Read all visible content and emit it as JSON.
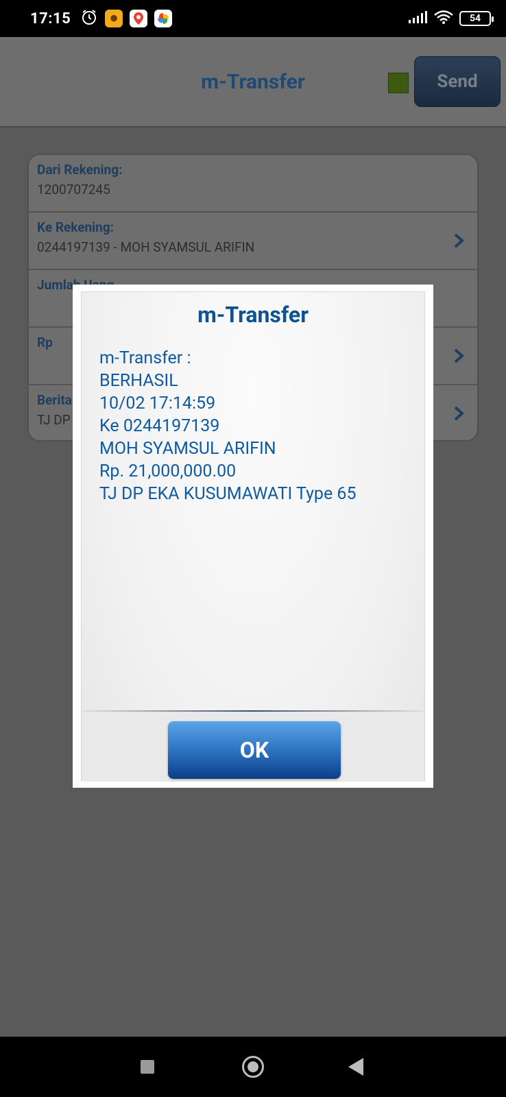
{
  "status_bar": {
    "time": "17:15",
    "battery_level": "54",
    "icons": [
      "alarm-icon",
      "shopee-icon",
      "maps-icon",
      "photos-icon",
      "signal-icon",
      "wifi-icon",
      "battery-icon"
    ]
  },
  "header": {
    "title": "m-Transfer",
    "send_label": "Send"
  },
  "form": {
    "rows": [
      {
        "label": "Dari Rekening:",
        "value": "1200707245"
      },
      {
        "label": "Ke Rekening:",
        "value": "0244197139 - MOH SYAMSUL ARIFIN"
      },
      {
        "label": "Jumlah Uang",
        "value": ""
      },
      {
        "label": "Rp",
        "value": ""
      },
      {
        "label": "Berita",
        "value": "TJ DP"
      }
    ]
  },
  "dialog": {
    "title": "m-Transfer",
    "lines": [
      "m-Transfer :",
      "BERHASIL",
      "10/02 17:14:59",
      "Ke 0244197139",
      "MOH SYAMSUL ARIFIN",
      "Rp. 21,000,000.00",
      "TJ DP EKA KUSUMAWATI Type 65"
    ],
    "ok_label": "OK"
  },
  "colors": {
    "accent": "#0f5290",
    "ok_button_top": "#5aa4e6",
    "ok_button_bottom": "#0b3f8a"
  }
}
